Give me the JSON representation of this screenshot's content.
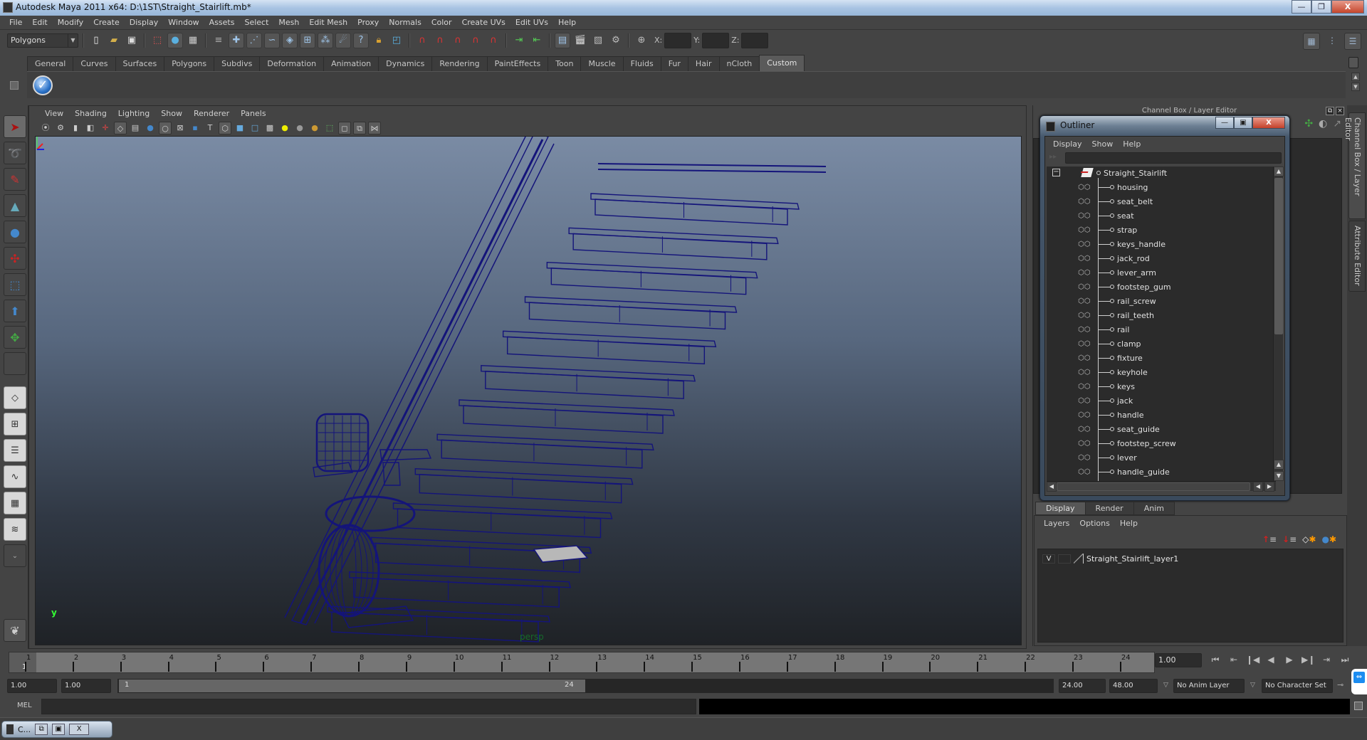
{
  "window": {
    "title": "Autodesk Maya 2011 x64: D:\\1ST\\Straight_Stairlift.mb*",
    "controls": {
      "minimize": "—",
      "restore": "❐",
      "close": "X"
    }
  },
  "menubar": [
    "File",
    "Edit",
    "Modify",
    "Create",
    "Display",
    "Window",
    "Assets",
    "Select",
    "Mesh",
    "Edit Mesh",
    "Proxy",
    "Normals",
    "Color",
    "Create UVs",
    "Edit UVs",
    "Help"
  ],
  "statusline": {
    "mode": "Polygons",
    "icons": [
      "new-scene",
      "open-scene",
      "save-scene",
      "select-hierarchy",
      "select-object",
      "select-component",
      "filter",
      "snap-grid",
      "snap-curve",
      "snap-point",
      "snap-view-plane",
      "snap-live",
      "construction-history",
      "render-current",
      "ipr-render",
      "render-settings",
      "hypershade",
      "input-lock",
      "selection-mask"
    ],
    "x_label": "X:",
    "y_label": "Y:",
    "z_label": "Z:",
    "x_value": "",
    "y_value": "",
    "z_value": ""
  },
  "shelf": {
    "tabs": [
      "General",
      "Curves",
      "Surfaces",
      "Polygons",
      "Subdivs",
      "Deformation",
      "Animation",
      "Dynamics",
      "Rendering",
      "PaintEffects",
      "Toon",
      "Muscle",
      "Fluids",
      "Fur",
      "Hair",
      "nCloth",
      "Custom"
    ],
    "active_tab": "Custom",
    "buttons": [
      "checkmark-shelf-button"
    ]
  },
  "toolbox": {
    "tools": [
      "select-tool",
      "lasso-tool",
      "paint-select-tool",
      "move-tool",
      "rotate-tool",
      "scale-tool",
      "universal-manipulator",
      "soft-mod-tool",
      "show-manipulator",
      "last-used-tool"
    ],
    "layouts": [
      "single-perspective",
      "four-view",
      "persp-outliner",
      "persp-graph",
      "hypershade-persp-graph",
      "persp-trax-graph",
      "more-layouts"
    ]
  },
  "viewport": {
    "menu": [
      "View",
      "Shading",
      "Lighting",
      "Show",
      "Renderer",
      "Panels"
    ],
    "camera": "persp",
    "axis_label": "y"
  },
  "channel_box": {
    "header": "Channel Box / Layer Editor",
    "side_tabs": [
      "Channel Box / Layer Editor",
      "Attribute Editor"
    ]
  },
  "outliner": {
    "title": "Outliner",
    "menu": [
      "Display",
      "Show",
      "Help"
    ],
    "filter_value": "",
    "root": "Straight_Stairlift",
    "items": [
      "housing",
      "seat_belt",
      "seat",
      "strap",
      "keys_handle",
      "jack_rod",
      "lever_arm",
      "footstep_gum",
      "rail_screw",
      "rail_teeth",
      "rail",
      "clamp",
      "fixture",
      "keyhole",
      "keys",
      "jack",
      "handle",
      "seat_guide",
      "footstep_screw",
      "lever",
      "handle_guide"
    ]
  },
  "layer_editor": {
    "tabs": [
      "Display",
      "Render",
      "Anim"
    ],
    "active_tab": "Display",
    "menu": [
      "Layers",
      "Options",
      "Help"
    ],
    "layers": [
      {
        "visible": "V",
        "name": "Straight_Stairlift_layer1"
      }
    ]
  },
  "timeline": {
    "ticks": [
      "1",
      "2",
      "3",
      "4",
      "5",
      "6",
      "7",
      "8",
      "9",
      "10",
      "11",
      "12",
      "13",
      "14",
      "15",
      "16",
      "17",
      "18",
      "19",
      "20",
      "21",
      "22",
      "23",
      "24"
    ],
    "current_marker": "1",
    "current_frame": "1.00",
    "playback": [
      "⏮",
      "⇤",
      "❙◀",
      "◀",
      "▶",
      "▶❙",
      "⇥",
      "⏭"
    ]
  },
  "range": {
    "start_time": "1.00",
    "playback_start": "1.00",
    "range_start": "1",
    "range_end": "24",
    "playback_end": "24.00",
    "end_time": "48.00",
    "anim_layer": "No Anim Layer",
    "character_set": "No Character Set"
  },
  "command_line": {
    "label": "MEL",
    "input": "",
    "output": ""
  },
  "taskbar": {
    "item": "C..."
  }
}
